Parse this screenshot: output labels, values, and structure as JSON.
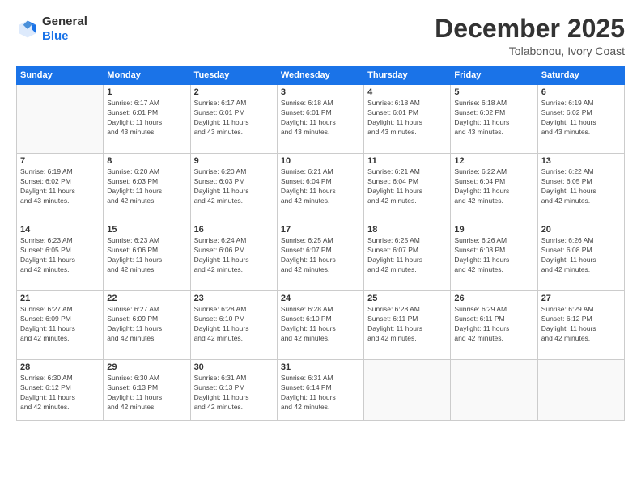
{
  "header": {
    "logo": {
      "general": "General",
      "blue": "Blue"
    },
    "title": "December 2025",
    "subtitle": "Tolabonou, Ivory Coast"
  },
  "weekdays": [
    "Sunday",
    "Monday",
    "Tuesday",
    "Wednesday",
    "Thursday",
    "Friday",
    "Saturday"
  ],
  "weeks": [
    [
      {
        "day": "",
        "detail": ""
      },
      {
        "day": "1",
        "detail": "Sunrise: 6:17 AM\nSunset: 6:01 PM\nDaylight: 11 hours\nand 43 minutes."
      },
      {
        "day": "2",
        "detail": "Sunrise: 6:17 AM\nSunset: 6:01 PM\nDaylight: 11 hours\nand 43 minutes."
      },
      {
        "day": "3",
        "detail": "Sunrise: 6:18 AM\nSunset: 6:01 PM\nDaylight: 11 hours\nand 43 minutes."
      },
      {
        "day": "4",
        "detail": "Sunrise: 6:18 AM\nSunset: 6:01 PM\nDaylight: 11 hours\nand 43 minutes."
      },
      {
        "day": "5",
        "detail": "Sunrise: 6:18 AM\nSunset: 6:02 PM\nDaylight: 11 hours\nand 43 minutes."
      },
      {
        "day": "6",
        "detail": "Sunrise: 6:19 AM\nSunset: 6:02 PM\nDaylight: 11 hours\nand 43 minutes."
      }
    ],
    [
      {
        "day": "7",
        "detail": "Sunrise: 6:19 AM\nSunset: 6:02 PM\nDaylight: 11 hours\nand 43 minutes."
      },
      {
        "day": "8",
        "detail": "Sunrise: 6:20 AM\nSunset: 6:03 PM\nDaylight: 11 hours\nand 42 minutes."
      },
      {
        "day": "9",
        "detail": "Sunrise: 6:20 AM\nSunset: 6:03 PM\nDaylight: 11 hours\nand 42 minutes."
      },
      {
        "day": "10",
        "detail": "Sunrise: 6:21 AM\nSunset: 6:04 PM\nDaylight: 11 hours\nand 42 minutes."
      },
      {
        "day": "11",
        "detail": "Sunrise: 6:21 AM\nSunset: 6:04 PM\nDaylight: 11 hours\nand 42 minutes."
      },
      {
        "day": "12",
        "detail": "Sunrise: 6:22 AM\nSunset: 6:04 PM\nDaylight: 11 hours\nand 42 minutes."
      },
      {
        "day": "13",
        "detail": "Sunrise: 6:22 AM\nSunset: 6:05 PM\nDaylight: 11 hours\nand 42 minutes."
      }
    ],
    [
      {
        "day": "14",
        "detail": "Sunrise: 6:23 AM\nSunset: 6:05 PM\nDaylight: 11 hours\nand 42 minutes."
      },
      {
        "day": "15",
        "detail": "Sunrise: 6:23 AM\nSunset: 6:06 PM\nDaylight: 11 hours\nand 42 minutes."
      },
      {
        "day": "16",
        "detail": "Sunrise: 6:24 AM\nSunset: 6:06 PM\nDaylight: 11 hours\nand 42 minutes."
      },
      {
        "day": "17",
        "detail": "Sunrise: 6:25 AM\nSunset: 6:07 PM\nDaylight: 11 hours\nand 42 minutes."
      },
      {
        "day": "18",
        "detail": "Sunrise: 6:25 AM\nSunset: 6:07 PM\nDaylight: 11 hours\nand 42 minutes."
      },
      {
        "day": "19",
        "detail": "Sunrise: 6:26 AM\nSunset: 6:08 PM\nDaylight: 11 hours\nand 42 minutes."
      },
      {
        "day": "20",
        "detail": "Sunrise: 6:26 AM\nSunset: 6:08 PM\nDaylight: 11 hours\nand 42 minutes."
      }
    ],
    [
      {
        "day": "21",
        "detail": "Sunrise: 6:27 AM\nSunset: 6:09 PM\nDaylight: 11 hours\nand 42 minutes."
      },
      {
        "day": "22",
        "detail": "Sunrise: 6:27 AM\nSunset: 6:09 PM\nDaylight: 11 hours\nand 42 minutes."
      },
      {
        "day": "23",
        "detail": "Sunrise: 6:28 AM\nSunset: 6:10 PM\nDaylight: 11 hours\nand 42 minutes."
      },
      {
        "day": "24",
        "detail": "Sunrise: 6:28 AM\nSunset: 6:10 PM\nDaylight: 11 hours\nand 42 minutes."
      },
      {
        "day": "25",
        "detail": "Sunrise: 6:28 AM\nSunset: 6:11 PM\nDaylight: 11 hours\nand 42 minutes."
      },
      {
        "day": "26",
        "detail": "Sunrise: 6:29 AM\nSunset: 6:11 PM\nDaylight: 11 hours\nand 42 minutes."
      },
      {
        "day": "27",
        "detail": "Sunrise: 6:29 AM\nSunset: 6:12 PM\nDaylight: 11 hours\nand 42 minutes."
      }
    ],
    [
      {
        "day": "28",
        "detail": "Sunrise: 6:30 AM\nSunset: 6:12 PM\nDaylight: 11 hours\nand 42 minutes."
      },
      {
        "day": "29",
        "detail": "Sunrise: 6:30 AM\nSunset: 6:13 PM\nDaylight: 11 hours\nand 42 minutes."
      },
      {
        "day": "30",
        "detail": "Sunrise: 6:31 AM\nSunset: 6:13 PM\nDaylight: 11 hours\nand 42 minutes."
      },
      {
        "day": "31",
        "detail": "Sunrise: 6:31 AM\nSunset: 6:14 PM\nDaylight: 11 hours\nand 42 minutes."
      },
      {
        "day": "",
        "detail": ""
      },
      {
        "day": "",
        "detail": ""
      },
      {
        "day": "",
        "detail": ""
      }
    ]
  ]
}
